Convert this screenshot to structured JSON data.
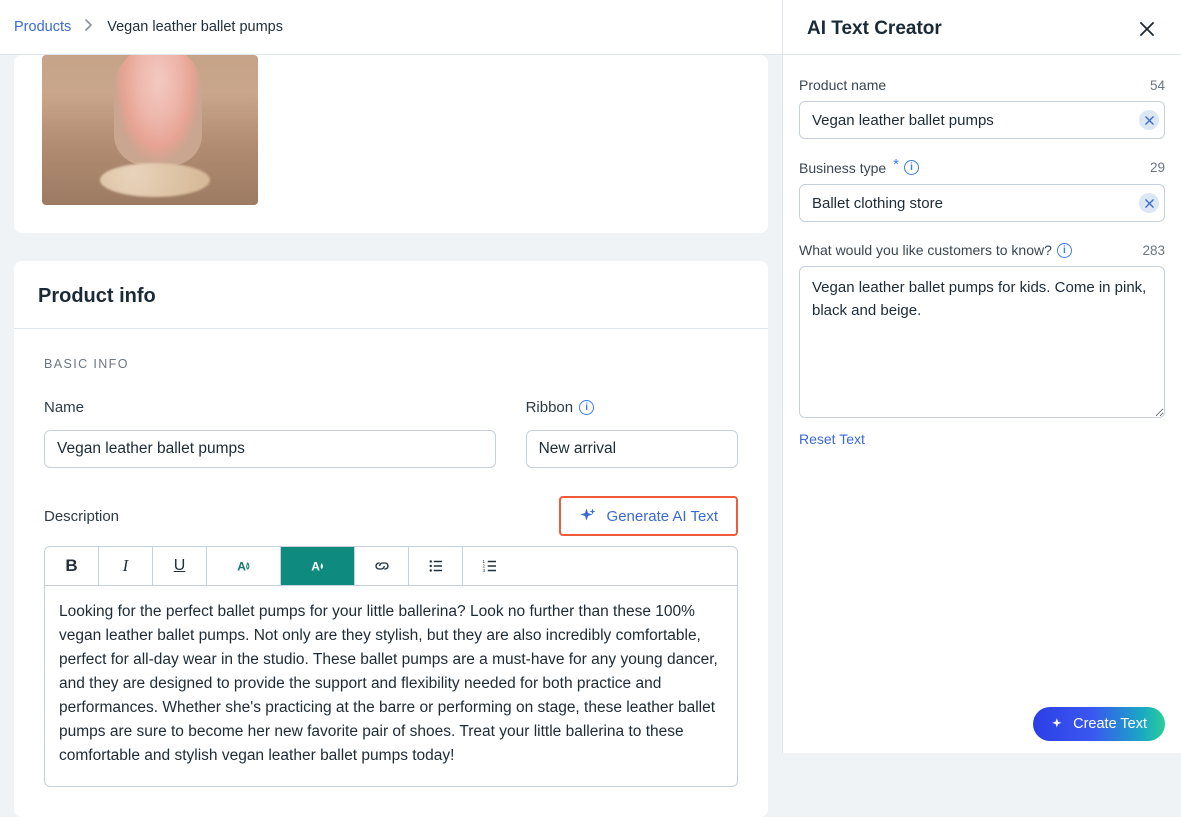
{
  "breadcrumb": {
    "root": "Products",
    "current": "Vegan leather ballet pumps"
  },
  "product_info": {
    "card_title": "Product info",
    "section_label": "BASIC INFO",
    "name_label": "Name",
    "name_value": "Vegan leather ballet pumps",
    "ribbon_label": "Ribbon",
    "ribbon_value": "New arrival",
    "description_label": "Description",
    "generate_ai_label": "Generate AI Text",
    "description_value": "Looking for the perfect ballet pumps for your little ballerina? Look no further than these 100% vegan leather ballet pumps. Not only are they stylish, but they are also incredibly comfortable, perfect for all-day wear in the studio. These ballet pumps are a must-have for any young dancer, and they are designed to provide the support and flexibility needed for both practice and performances. Whether she's practicing at the barre or performing on stage, these leather ballet pumps are sure to become her new favorite pair of shoes. Treat your little ballerina to these comfortable and stylish vegan leather ballet pumps today!"
  },
  "side_panel": {
    "title": "AI Text Creator",
    "product_name_label": "Product name",
    "product_name_count": "54",
    "product_name_value": "Vegan leather ballet pumps",
    "business_type_label": "Business type",
    "business_type_count": "29",
    "business_type_value": "Ballet clothing store",
    "know_label": "What would you like customers to know?",
    "know_count": "283",
    "know_value": "Vegan leather ballet pumps for kids. Come in pink, black and beige.",
    "reset_label": "Reset Text",
    "create_label": "Create Text"
  }
}
